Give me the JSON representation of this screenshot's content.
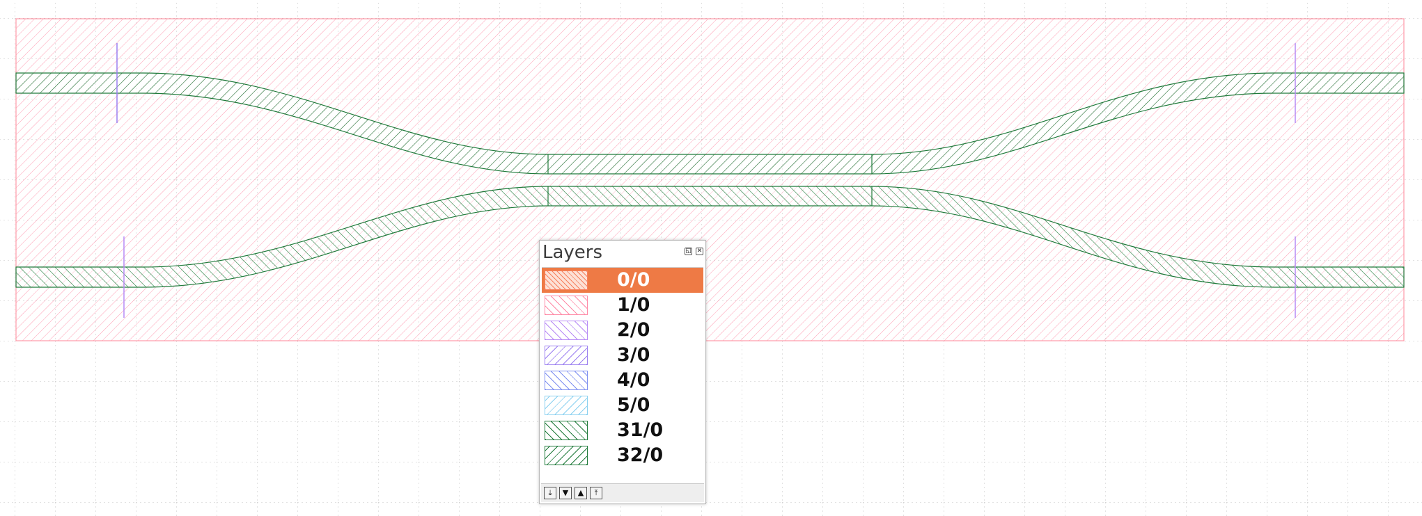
{
  "layers_panel": {
    "title": "Layers",
    "float_icon": "float-window-icon",
    "close_icon": "close-icon",
    "items": [
      {
        "label": "0/0",
        "color": "#f7805e",
        "selected": true,
        "pattern": "dense-diagonal"
      },
      {
        "label": "1/0",
        "color": "#ff8aa6",
        "selected": false,
        "pattern": "diagonal"
      },
      {
        "label": "2/0",
        "color": "#b78af5",
        "selected": false,
        "pattern": "diagonal"
      },
      {
        "label": "3/0",
        "color": "#9b7ff0",
        "selected": false,
        "pattern": "back-diagonal"
      },
      {
        "label": "4/0",
        "color": "#7d8ef0",
        "selected": false,
        "pattern": "diagonal"
      },
      {
        "label": "5/0",
        "color": "#8ad0f0",
        "selected": false,
        "pattern": "back-diagonal"
      },
      {
        "label": "31/0",
        "color": "#1f7a3a",
        "selected": false,
        "pattern": "diagonal"
      },
      {
        "label": "32/0",
        "color": "#1f7a3a",
        "selected": false,
        "pattern": "back-diagonal"
      }
    ],
    "toolbar_icons": [
      "move-to-bottom-icon",
      "move-down-icon",
      "move-up-icon",
      "move-to-top-icon"
    ]
  },
  "canvas": {
    "background_color": "#ffffff",
    "grid_color": "#c8c8c8",
    "cladding_layer": "1/0",
    "waveguide_layer_top": "31/0",
    "waveguide_layer_bottom": "32/0",
    "marker_layers": [
      "2/0",
      "4/0"
    ]
  }
}
